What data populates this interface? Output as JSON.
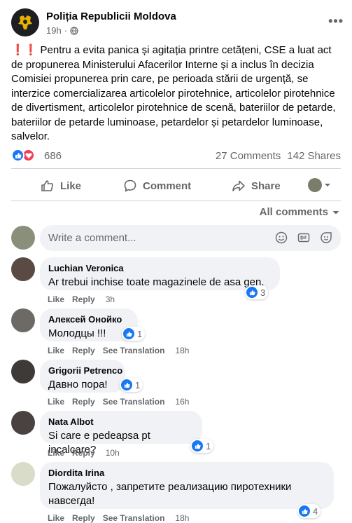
{
  "post": {
    "page_name": "Poliția Republicii Moldova",
    "time": "19h",
    "text": "Pentru a evita panica și agitația printre cetățeni, CSE a luat act de propunerea Ministerului Afacerilor Interne și a inclus în decizia Comisiei propunerea prin care, pe perioada stării de urgență, se interzice comercializarea articolelor pirotehnice, articolelor pirotehnice de divertisment, articolelor pirotehnice de scenă, bateriilor de petarde, bateriilor de petarde luminoase, petardelor și petardelor luminoase, salvelor.",
    "emoji": "❗❗",
    "reactions_count": "686",
    "comments_count": "27 Comments",
    "shares_count": "142 Shares"
  },
  "actions": {
    "like": "Like",
    "comment": "Comment",
    "share": "Share"
  },
  "all_comments_label": "All comments",
  "composer": {
    "placeholder": "Write a comment..."
  },
  "comments": [
    {
      "name": "Luchian Veronica",
      "text": "Ar trebui inchise toate magazinele de asa gen.",
      "likes": "3",
      "like": "Like",
      "reply": "Reply",
      "translation": "",
      "time": "3h"
    },
    {
      "name": "Алексей Онойко",
      "text": "Молодцы !!!",
      "likes": "1",
      "like": "Like",
      "reply": "Reply",
      "translation": "See Translation",
      "time": "18h"
    },
    {
      "name": "Grigorii Petrenco",
      "text": "Давно пора!",
      "likes": "1",
      "like": "Like",
      "reply": "Reply",
      "translation": "See Translation",
      "time": "16h"
    },
    {
      "name": "Nata Albot",
      "text": "Si care e pedeapsa pt incalcare?",
      "likes": "1",
      "like": "Like",
      "reply": "Reply",
      "translation": "",
      "time": "10h"
    },
    {
      "name": "Diordita Irina",
      "text": "Пожалуйсто , запретите реализацию пиротехники навсегда!",
      "likes": "4",
      "like": "Like",
      "reply": "Reply",
      "translation": "See Translation",
      "time": "18h"
    }
  ],
  "colors": {
    "accent": "#1877f2",
    "love": "#f33e58",
    "muted": "#65676b",
    "bubble": "#f0f2f5",
    "page_avatar_bg": "#1c1e21",
    "page_avatar_gold": "#e8b100"
  },
  "icons": {
    "globe": "globe-icon",
    "more": "more-icon",
    "like": "thumbs-up-icon",
    "comment": "comment-icon",
    "share": "share-icon",
    "dropdown": "caret-down-icon",
    "emoji": "emoji-icon",
    "gif": "gif-icon",
    "sticker": "sticker-icon"
  }
}
